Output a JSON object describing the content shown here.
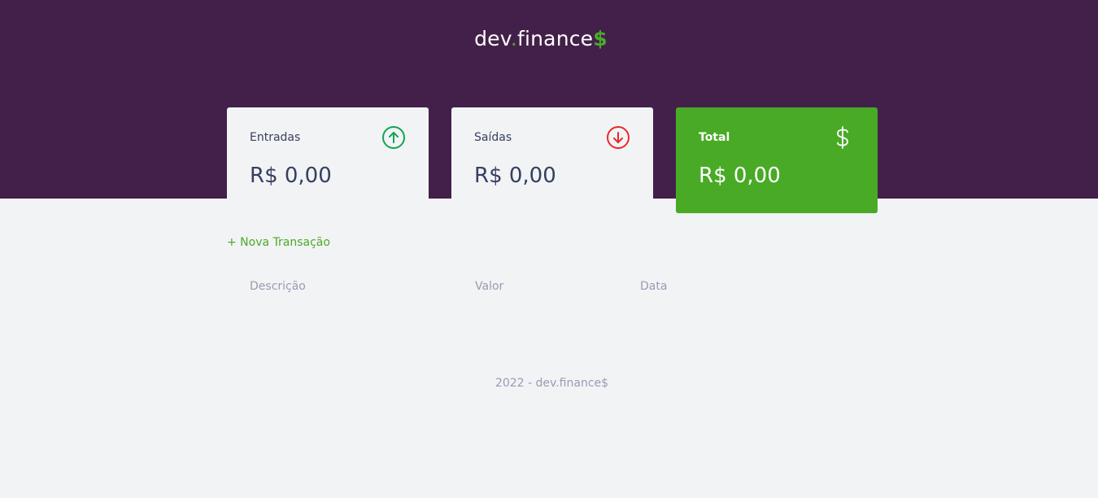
{
  "header": {
    "logo": {
      "prefix": "dev",
      "dot": ".",
      "name": "finance",
      "suffix": "$"
    }
  },
  "cards": {
    "income": {
      "label": "Entradas",
      "amount": "R$ 0,00",
      "icon": "arrow-up-circle-icon",
      "icon_color": "#12a454"
    },
    "expense": {
      "label": "Saídas",
      "amount": "R$ 0,00",
      "icon": "arrow-down-circle-icon",
      "icon_color": "#e92929"
    },
    "total": {
      "label": "Total",
      "amount": "R$ 0,00",
      "icon": "dollar-sign-icon",
      "background": "#49aa26"
    }
  },
  "actions": {
    "new_transaction": "+ Nova Transação"
  },
  "table": {
    "headers": [
      "Descrição",
      "Valor",
      "Data"
    ],
    "rows": []
  },
  "footer": {
    "text": "2022 - dev.finance$"
  },
  "colors": {
    "header_bg": "#43204a",
    "accent": "#49aa26",
    "page_bg": "#f2f3f5",
    "text_dark": "#363f5f",
    "text_muted": "#969cb3"
  }
}
